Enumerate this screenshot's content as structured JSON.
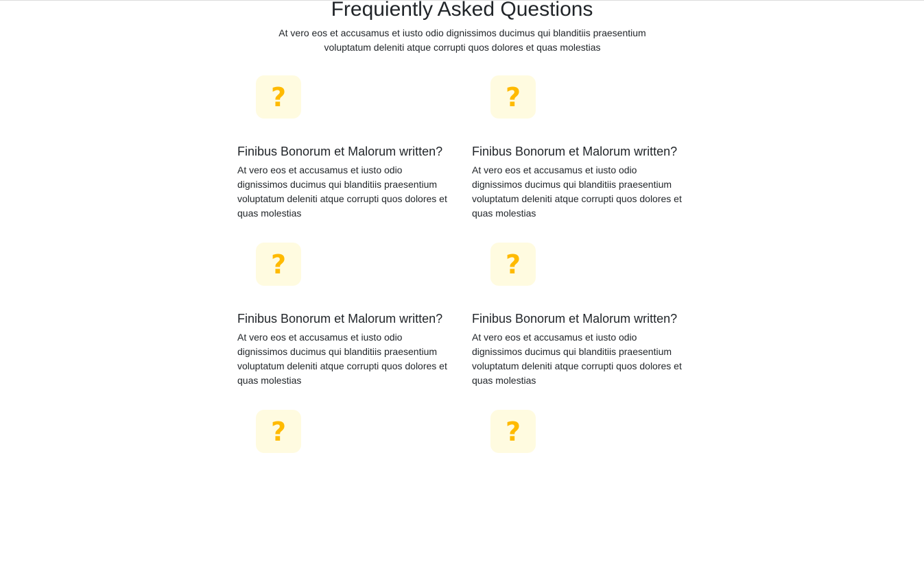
{
  "faq": {
    "title": "Frequiently Asked Questions",
    "subtitle": "At vero eos et accusamus et iusto odio dignissimos ducimus qui blanditiis praesentium voluptatum deleniti atque corrupti quos dolores et quas molestias",
    "icon": {
      "name": "question-mark-icon",
      "glyph": "?",
      "color": "#ffba00",
      "background": "#fffbe0"
    },
    "items": [
      {
        "question": "Finibus Bonorum et Malorum written?",
        "answer": "At vero eos et accusamus et iusto odio dignissimos ducimus qui blanditiis praesentium voluptatum deleniti atque corrupti quos dolores et quas molestias"
      },
      {
        "question": "Finibus Bonorum et Malorum written?",
        "answer": "At vero eos et accusamus et iusto odio dignissimos ducimus qui blanditiis praesentium voluptatum deleniti atque corrupti quos dolores et quas molestias"
      },
      {
        "question": "Finibus Bonorum et Malorum written?",
        "answer": "At vero eos et accusamus et iusto odio dignissimos ducimus qui blanditiis praesentium voluptatum deleniti atque corrupti quos dolores et quas molestias"
      },
      {
        "question": "Finibus Bonorum et Malorum written?",
        "answer": "At vero eos et accusamus et iusto odio dignissimos ducimus qui blanditiis praesentium voluptatum deleniti atque corrupti quos dolores et quas molestias"
      },
      {
        "question": "",
        "answer": ""
      },
      {
        "question": "",
        "answer": ""
      }
    ]
  }
}
